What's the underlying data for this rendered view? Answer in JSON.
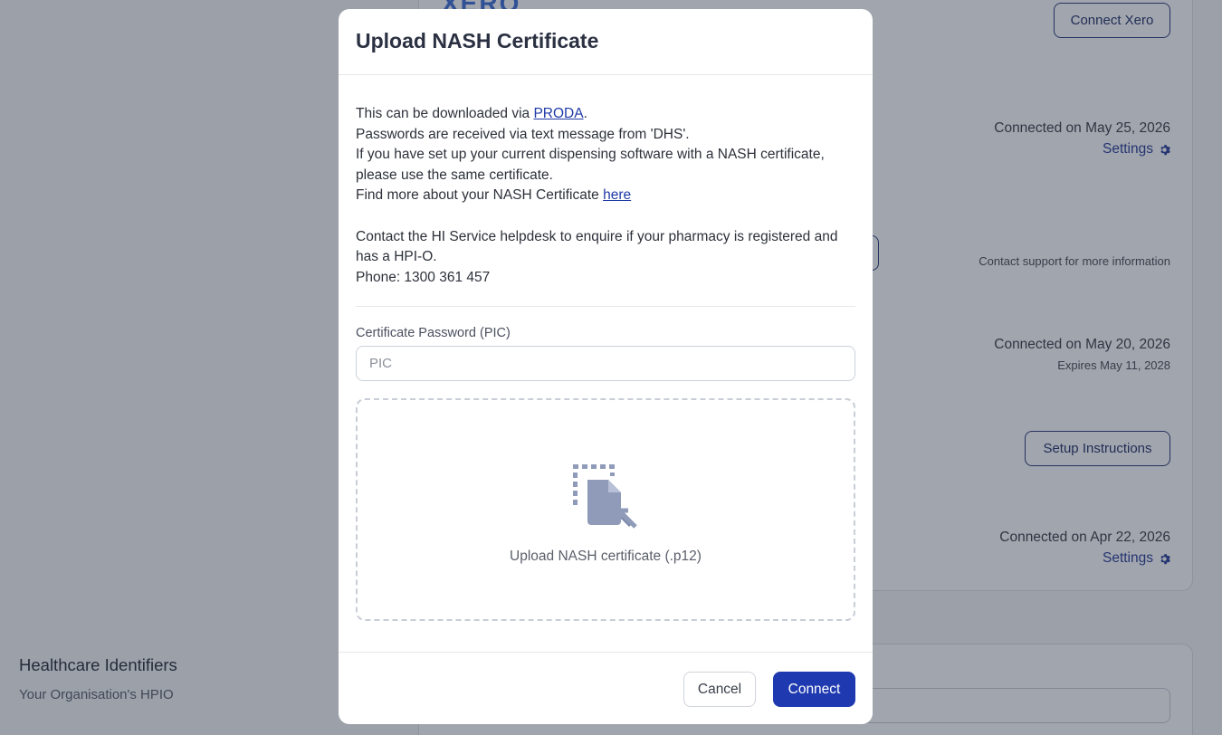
{
  "background": {
    "xero_logo": "XERO",
    "connect_xero_label": "Connect Xero",
    "row1": {
      "status": "Connected on May 25, 2026",
      "settings_label": "Settings"
    },
    "row2": {
      "note": "Contact support for more information"
    },
    "row3": {
      "status": "Connected on May 20, 2026",
      "expires": "Expires May 11, 2028"
    },
    "row4": {
      "setup_label": "Setup Instructions"
    },
    "row5": {
      "status": "Connected on Apr 22, 2026",
      "settings_label": "Settings"
    },
    "healthcare_title": "Healthcare Identifiers",
    "healthcare_subtitle": "Your Organisation's HPIO"
  },
  "modal": {
    "title": "Upload NASH Certificate",
    "info": {
      "line1_prefix": "This can be downloaded via ",
      "line1_link": "PRODA",
      "line1_suffix": ".",
      "line2": "Passwords are received via text message from 'DHS'.",
      "line3": "If you have set up your current dispensing software with a NASH certificate, please use the same certificate.",
      "line4_prefix": "Find more about your NASH Certificate ",
      "line4_link": "here",
      "line5": "Contact the HI Service helpdesk to enquire if your pharmacy is registered and has a HPI-O.",
      "line6": "Phone: 1300 361 457"
    },
    "password_label": "Certificate Password (PIC)",
    "password_placeholder": "PIC",
    "password_value": "",
    "upload_label": "Upload NASH certificate (.p12)",
    "cancel_label": "Cancel",
    "connect_label": "Connect"
  },
  "colors": {
    "primary": "#1f3ab0",
    "link": "#1f3aa6",
    "overlay": "rgba(30,40,60,0.42)"
  },
  "icons": {
    "upload": "file-upload-icon",
    "settings": "gear-icon"
  }
}
